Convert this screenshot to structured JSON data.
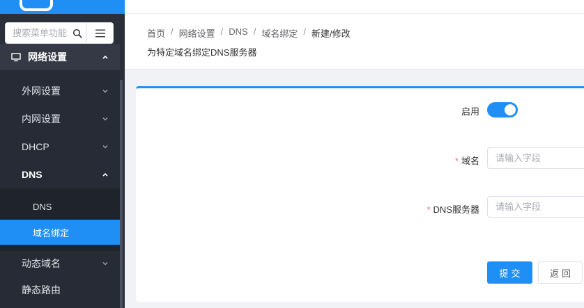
{
  "sidebar": {
    "search_placeholder": "搜索菜单功能",
    "main_menu": "网络设置",
    "items": [
      {
        "label": "外网设置"
      },
      {
        "label": "内网设置"
      },
      {
        "label": "DHCP"
      },
      {
        "label": "DNS"
      },
      {
        "label": "动态域名"
      },
      {
        "label": "静态路由"
      }
    ],
    "dns_children": [
      {
        "label": "DNS"
      },
      {
        "label": "域名绑定"
      }
    ]
  },
  "header": {
    "breadcrumb": [
      "首页",
      "网络设置",
      "DNS",
      "域名绑定",
      "新建/修改"
    ],
    "separator": "/",
    "subtitle": "为特定域名绑定DNS服务器"
  },
  "form": {
    "enable_label": "启用",
    "enabled": true,
    "domain_label": "域名",
    "domain_placeholder": "请输入字段",
    "dns_label": "DNS服务器",
    "dns_placeholder": "请输入字段",
    "required_mark": "*",
    "submit_label": "提交",
    "back_label": "返回"
  },
  "colors": {
    "accent": "#1f8ff5",
    "sidebar_bg": "#2a2f3a",
    "required": "#f56c6c"
  }
}
